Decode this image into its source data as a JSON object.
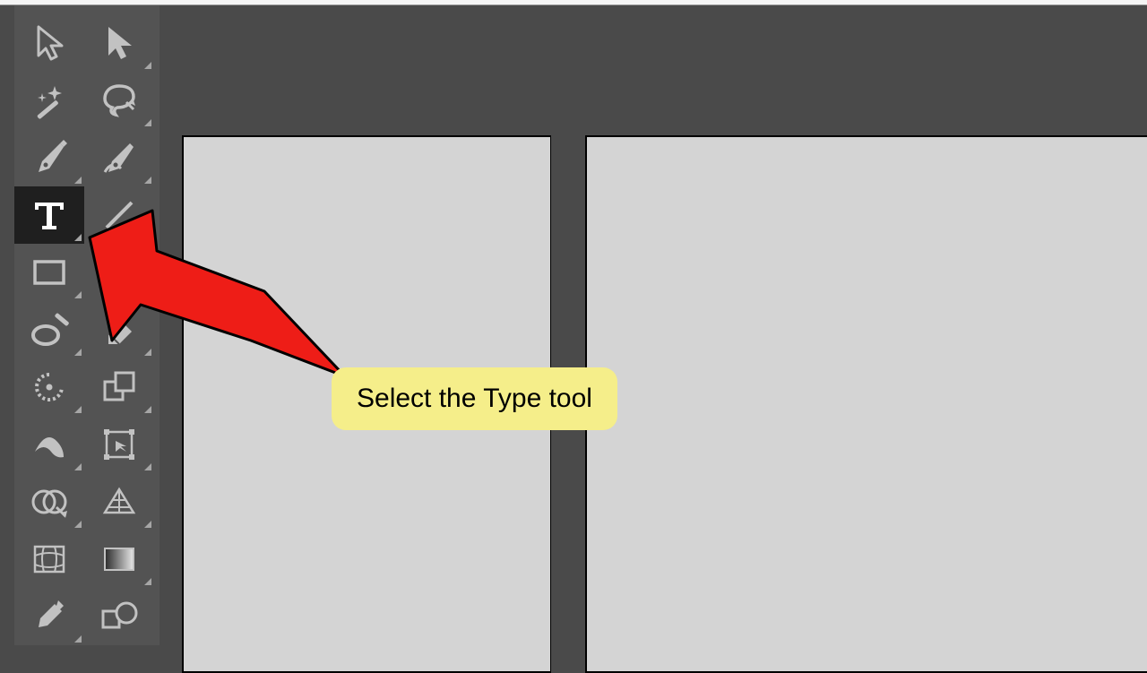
{
  "tooltip": {
    "text": "Select the Type tool"
  },
  "tools": {
    "selection": "Selection Tool",
    "direct_selection": "Direct Selection Tool",
    "wand": "Magic Wand Tool",
    "lasso": "Lasso Tool",
    "pen": "Pen Tool",
    "curvature": "Curvature Tool",
    "type": "Type Tool",
    "line": "Line Segment Tool",
    "rectangle": "Rectangle Tool",
    "paintbrush": "Paintbrush Tool",
    "shaper": "Shaper Tool",
    "eraser": "Eraser Tool",
    "rotate": "Rotate Tool",
    "scale": "Scale Tool",
    "width": "Width Tool",
    "free_transform": "Free Transform Tool",
    "shape_builder": "Shape Builder Tool",
    "perspective": "Perspective Grid Tool",
    "mesh": "Mesh Tool",
    "gradient": "Gradient Tool",
    "eyedropper": "Eyedropper Tool",
    "blend": "Blend Tool"
  },
  "colors": {
    "toolbar_bg": "#535353",
    "canvas_bg": "#4a4a4a",
    "page_bg": "#d4d4d4",
    "selected_bg": "#1f1f1f",
    "tooltip_bg": "#f5ee8a",
    "arrow_fill": "#ee1d17",
    "icon_fill": "#c2c2c2"
  }
}
